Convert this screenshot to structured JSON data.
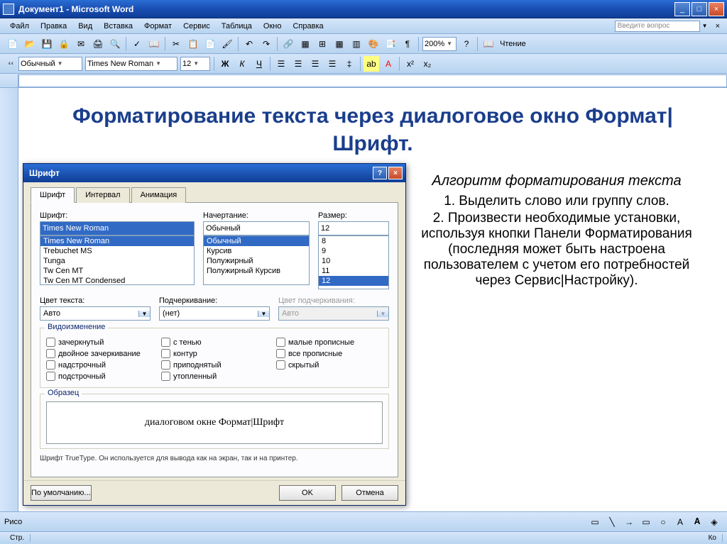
{
  "window": {
    "title": "Документ1 - Microsoft Word"
  },
  "menu": {
    "file": "Файл",
    "edit": "Правка",
    "view": "Вид",
    "insert": "Вставка",
    "format": "Формат",
    "tools": "Сервис",
    "table": "Таблица",
    "window": "Окно",
    "help": "Справка",
    "help_placeholder": "Введите вопрос"
  },
  "toolbar": {
    "zoom": "200%",
    "reading": "Чтение",
    "style": "Обычный",
    "font": "Times New Roman",
    "size": "12"
  },
  "document": {
    "heading": "Форматирование текста через диалоговое окно Формат|Шрифт.",
    "subtitle": "Алгоритм форматирования текста",
    "step1": "1. Выделить слово или группу слов.",
    "step2": "2. Произвести необходимые установки, используя кнопки Панели Форматирования (последняя может быть настроена пользователем с учетом его потребностей через Сервис|Настройку)."
  },
  "dialog": {
    "title": "Шрифт",
    "tab1": "Шрифт",
    "tab2": "Интервал",
    "tab3": "Анимация",
    "font_label": "Шрифт:",
    "font_value": "Times New Roman",
    "font_list": [
      "Times New Roman",
      "Trebuchet MS",
      "Tunga",
      "Tw Cen MT",
      "Tw Cen MT Condensed"
    ],
    "style_label": "Начертание:",
    "style_value": "Обычный",
    "style_list": [
      "Обычный",
      "Курсив",
      "Полужирный",
      "Полужирный Курсив"
    ],
    "size_label": "Размер:",
    "size_value": "12",
    "size_list": [
      "8",
      "9",
      "10",
      "11",
      "12"
    ],
    "color_label": "Цвет текста:",
    "color_value": "Авто",
    "underline_label": "Подчеркивание:",
    "underline_value": "(нет)",
    "underline_color_label": "Цвет подчеркивания:",
    "underline_color_value": "Авто",
    "effects_title": "Видоизменение",
    "efx": {
      "strike": "зачеркнутый",
      "dblstrike": "двойное зачеркивание",
      "super": "надстрочный",
      "sub": "подстрочный",
      "shadow": "с тенью",
      "outline": "контур",
      "emboss": "приподнятый",
      "engrave": "утопленный",
      "smallcaps": "малые прописные",
      "allcaps": "все прописные",
      "hidden": "скрытый"
    },
    "preview_title": "Образец",
    "preview_text": "диалоговом окне Формат|Шрифт",
    "hint": "Шрифт TrueType. Он используется для вывода как на экран, так и на принтер.",
    "default_btn": "По умолчанию...",
    "ok_btn": "OK",
    "cancel_btn": "Отмена"
  },
  "bottom": {
    "draw": "Рисо",
    "status_page": "Стр.",
    "status_col": "Ко"
  }
}
